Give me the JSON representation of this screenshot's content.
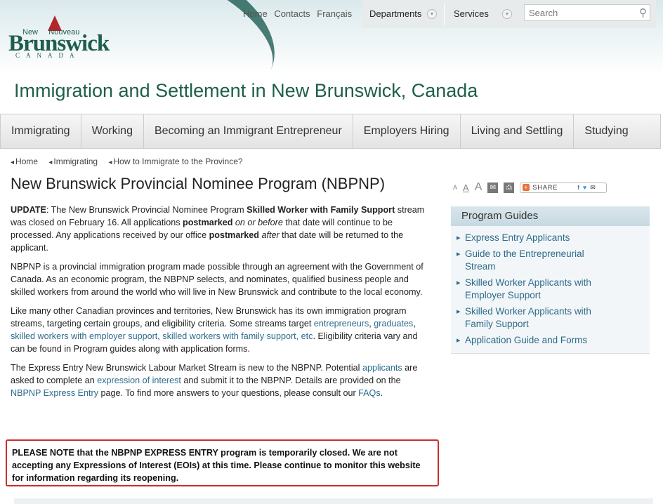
{
  "header": {
    "logo": {
      "line1": "New",
      "line1b": "Nouveau",
      "name": "Brunswick",
      "country": "CANADA"
    },
    "top_links": [
      "Home",
      "Contacts",
      "Français"
    ],
    "departments": "Departments",
    "services": "Services",
    "search_placeholder": "Search"
  },
  "site_title": "Immigration and Settlement in New Brunswick, Canada",
  "nav": [
    "Immigrating",
    "Working",
    "Becoming an Immigrant Entrepreneur",
    "Employers Hiring",
    "Living and Settling",
    "Studying"
  ],
  "breadcrumb": [
    "Home",
    "Immigrating",
    "How to Immigrate to the Province?"
  ],
  "page_title": "New Brunswick Provincial Nominee Program (NBPNP)",
  "paragraphs": [
    [
      {
        "t": "UPDATE",
        "s": "b"
      },
      {
        "t": ": The New Brunswick Provincial Nominee Program "
      },
      {
        "t": "Skilled Worker with Family Support",
        "s": "b"
      },
      {
        "t": " stream was closed on February 16. All applications "
      },
      {
        "t": "postmarked",
        "s": "b"
      },
      {
        "t": " "
      },
      {
        "t": "on or before",
        "s": "i"
      },
      {
        "t": " that date will continue to be processed. Any applications received by our office "
      },
      {
        "t": "postmarked",
        "s": "b"
      },
      {
        "t": " "
      },
      {
        "t": "after",
        "s": "i"
      },
      {
        "t": " that date will be returned to the applicant."
      }
    ],
    [
      {
        "t": "NBPNP is a provincial immigration program made possible through an agreement with the Government of Canada. As an economic program, the NBPNP selects, and nominates, qualified business people and skilled workers from around the world who will live in New Brunswick and contribute to the local economy."
      }
    ],
    [
      {
        "t": "Like many other Canadian provinces and territories, New Brunswick has its own immigration program streams, targeting certain groups, and eligibility criteria. Some streams target "
      },
      {
        "t": "entrepreneurs",
        "s": "a"
      },
      {
        "t": ", "
      },
      {
        "t": "graduates",
        "s": "a"
      },
      {
        "t": ", "
      },
      {
        "t": "skilled workers with employer support",
        "s": "a"
      },
      {
        "t": ", "
      },
      {
        "t": "skilled workers with family support, etc",
        "s": "a"
      },
      {
        "t": ". Eligibility criteria vary and can be found in  Program guides along with application forms."
      }
    ],
    [
      {
        "t": "The Express Entry New Brunswick Labour Market Stream is new to the NBPNP. Potential "
      },
      {
        "t": "applicants",
        "s": "a"
      },
      {
        "t": " are asked to complete an "
      },
      {
        "t": "expression of interest",
        "s": "a"
      },
      {
        "t": " and submit it to the NBPNP. Details are provided on the "
      },
      {
        "t": "NBPNP Express Entry",
        "s": "a"
      },
      {
        "t": " page. To find more answers to your questions, please consult our "
      },
      {
        "t": "FAQs",
        "s": "a"
      },
      {
        "t": "."
      }
    ]
  ],
  "notice": "PLEASE NOTE that the NBPNP EXPRESS ENTRY program is temporarily closed. We are not accepting any Expressions of Interest (EOIs) at this time. Please continue to monitor this website for information regarding its reopening.",
  "tools": {
    "share": "SHARE",
    "text_size": "A"
  },
  "sidebar": {
    "title": "Program Guides",
    "items": [
      "Express Entry Applicants",
      "Guide to the Entrepreneurial Stream",
      "Skilled Worker Applicants with Employer Support",
      "Skilled Worker Applicants with Family Support",
      "Application Guide and Forms"
    ]
  },
  "colors": {
    "brand": "#1f5e4c",
    "link": "#2c6b8a",
    "notice_border": "#c9302c"
  }
}
